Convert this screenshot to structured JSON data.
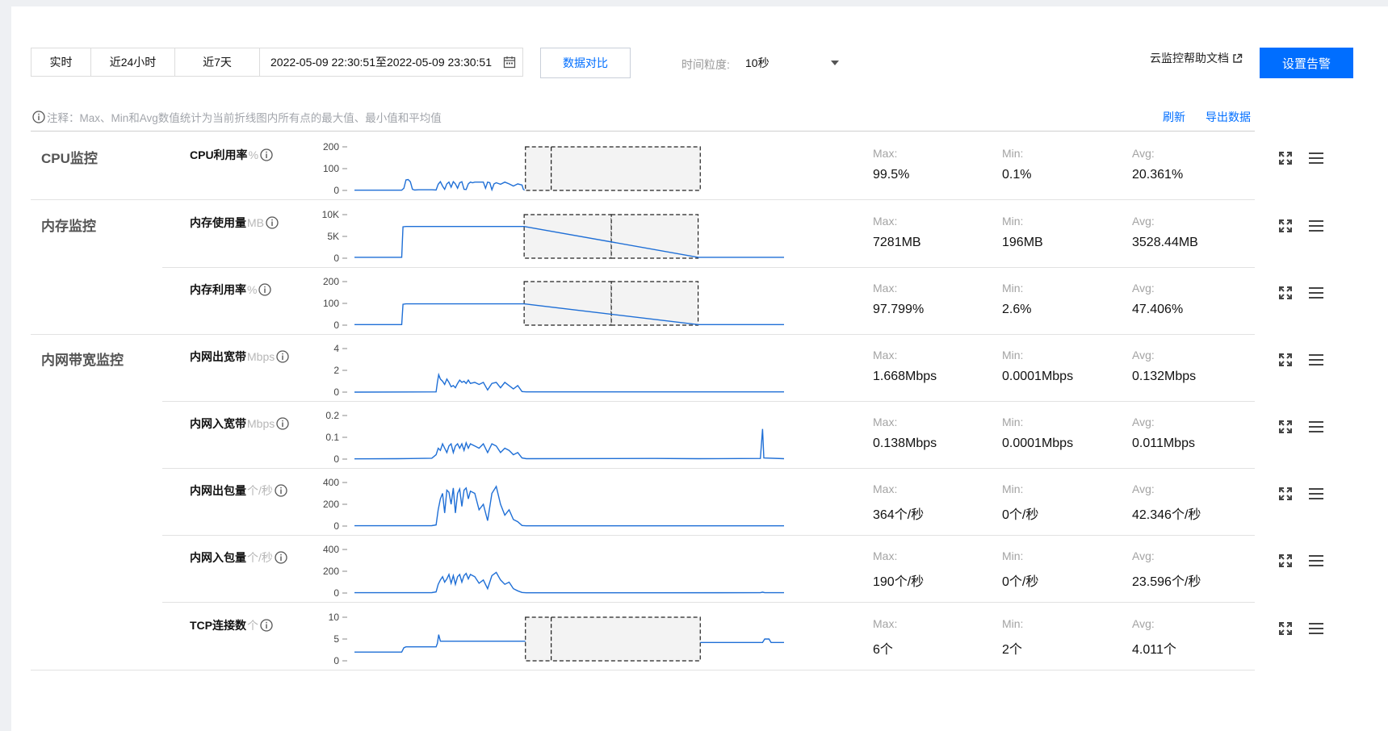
{
  "toolbar": {
    "tabs": [
      "实时",
      "近24小时",
      "近7天"
    ],
    "date_range": "2022-05-09 22:30:51至2022-05-09 23:30:51",
    "compare_label": "数据对比",
    "granularity_label": "时间粒度:",
    "granularity_value": "10秒",
    "help_link": "云监控帮助文档",
    "alarm_button": "设置告警"
  },
  "note": "注释：Max、Min和Avg数值统计为当前折线图内所有点的最大值、最小值和平均值",
  "actions": {
    "refresh": "刷新",
    "export": "导出数据"
  },
  "stat_labels": {
    "max": "Max:",
    "min": "Min:",
    "avg": "Avg:"
  },
  "colors": {
    "accent": "#006eff",
    "line": "#1f6fd6"
  },
  "groups": [
    {
      "title": "CPU监控"
    },
    {
      "title": "内存监控"
    },
    {
      "title": "内网带宽监控"
    }
  ],
  "metrics": [
    {
      "name": "CPU利用率",
      "unit": "%",
      "ticks": [
        "200",
        "100",
        "0"
      ],
      "ymax": 200,
      "max": "99.5%",
      "min": "0.1%",
      "avg": "20.361%",
      "series": [
        [
          0,
          1
        ],
        [
          8,
          1
        ],
        [
          11,
          1
        ],
        [
          11.5,
          10
        ],
        [
          12,
          48
        ],
        [
          12.5,
          50
        ],
        [
          13,
          40
        ],
        [
          13.5,
          5
        ],
        [
          14,
          2
        ],
        [
          15,
          3
        ],
        [
          18,
          3
        ],
        [
          19,
          2
        ],
        [
          19.5,
          28
        ],
        [
          20,
          40
        ],
        [
          20.5,
          20
        ],
        [
          21,
          5
        ],
        [
          21.5,
          30
        ],
        [
          22,
          38
        ],
        [
          22.5,
          15
        ],
        [
          23,
          40
        ],
        [
          23.5,
          30
        ],
        [
          24,
          10
        ],
        [
          24.5,
          35
        ],
        [
          25,
          40
        ],
        [
          25.5,
          5
        ],
        [
          26,
          4
        ],
        [
          26.5,
          30
        ],
        [
          27,
          38
        ],
        [
          27.5,
          35
        ],
        [
          28,
          38
        ],
        [
          29,
          38
        ],
        [
          30,
          38
        ],
        [
          30.5,
          10
        ],
        [
          31,
          38
        ],
        [
          31.5,
          35
        ],
        [
          32,
          3
        ],
        [
          32.5,
          30
        ],
        [
          33,
          35
        ],
        [
          34,
          28
        ],
        [
          35,
          38
        ],
        [
          36,
          30
        ],
        [
          37,
          20
        ],
        [
          38,
          30
        ],
        [
          39,
          25
        ],
        [
          39.3,
          5
        ],
        [
          39.6,
          1
        ],
        [
          50,
          1
        ],
        [
          80,
          1
        ],
        [
          100,
          1
        ]
      ],
      "gaps": [
        [
          39.8,
          45.8
        ],
        [
          45.8,
          80.5
        ]
      ]
    },
    {
      "name": "内存使用量",
      "unit": "MB",
      "ticks": [
        "10K",
        "5K",
        "0"
      ],
      "ymax": 10000,
      "max": "7281MB",
      "min": "196MB",
      "avg": "3528.44MB",
      "series": [
        [
          0,
          196
        ],
        [
          11,
          196
        ],
        [
          11.3,
          7200
        ],
        [
          12,
          7281
        ],
        [
          39.5,
          7281
        ],
        [
          80,
          196
        ],
        [
          100,
          196
        ]
      ],
      "gaps": [
        [
          39.5,
          59.8
        ],
        [
          59.8,
          80
        ]
      ]
    },
    {
      "name": "内存利用率",
      "unit": "%",
      "ticks": [
        "200",
        "100",
        "0"
      ],
      "ymax": 200,
      "max": "97.799%",
      "min": "2.6%",
      "avg": "47.406%",
      "series": [
        [
          0,
          2.6
        ],
        [
          11,
          2.6
        ],
        [
          11.3,
          96
        ],
        [
          12,
          97.8
        ],
        [
          39.5,
          97.8
        ],
        [
          80,
          2.6
        ],
        [
          100,
          2.6
        ]
      ],
      "gaps": [
        [
          39.5,
          59.8
        ],
        [
          59.8,
          80
        ]
      ]
    },
    {
      "name": "内网出宽带",
      "unit": "Mbps",
      "ticks": [
        "4",
        "2",
        "0"
      ],
      "ymax": 4,
      "max": "1.668Mbps",
      "min": "0.0001Mbps",
      "avg": "0.132Mbps",
      "series": [
        [
          0,
          0
        ],
        [
          19,
          0.02
        ],
        [
          19.3,
          0.9
        ],
        [
          19.6,
          1.6
        ],
        [
          20,
          1.2
        ],
        [
          20.5,
          1.0
        ],
        [
          21,
          0.7
        ],
        [
          21.5,
          1.2
        ],
        [
          22,
          0.9
        ],
        [
          22.5,
          0.5
        ],
        [
          23,
          0.6
        ],
        [
          23.5,
          0.4
        ],
        [
          24,
          0.8
        ],
        [
          24.5,
          1.1
        ],
        [
          25,
          0.9
        ],
        [
          25.5,
          1.0
        ],
        [
          26,
          0.8
        ],
        [
          26.5,
          1.1
        ],
        [
          27,
          0.8
        ],
        [
          28,
          0.9
        ],
        [
          29,
          0.7
        ],
        [
          30,
          0.9
        ],
        [
          31,
          0.2
        ],
        [
          32,
          0.8
        ],
        [
          33,
          0.9
        ],
        [
          34,
          0.4
        ],
        [
          35,
          0.9
        ],
        [
          36,
          0.6
        ],
        [
          37,
          0.3
        ],
        [
          38,
          0.6
        ],
        [
          39,
          0.05
        ],
        [
          40,
          0.02
        ],
        [
          100,
          0.02
        ]
      ],
      "gaps": []
    },
    {
      "name": "内网入宽带",
      "unit": "Mbps",
      "ticks": [
        "0.2",
        "0.1",
        "0"
      ],
      "ymax": 0.2,
      "max": "0.138Mbps",
      "min": "0.0001Mbps",
      "avg": "0.011Mbps",
      "series": [
        [
          0,
          0.001
        ],
        [
          10,
          0.002
        ],
        [
          18,
          0.004
        ],
        [
          19,
          0.02
        ],
        [
          19.5,
          0.05
        ],
        [
          20,
          0.04
        ],
        [
          20.5,
          0.07
        ],
        [
          21,
          0.05
        ],
        [
          21.5,
          0.03
        ],
        [
          22,
          0.06
        ],
        [
          22.5,
          0.07
        ],
        [
          23,
          0.03
        ],
        [
          23.5,
          0.06
        ],
        [
          24,
          0.07
        ],
        [
          24.5,
          0.05
        ],
        [
          25,
          0.07
        ],
        [
          25.5,
          0.04
        ],
        [
          26,
          0.075
        ],
        [
          26.5,
          0.05
        ],
        [
          27,
          0.07
        ],
        [
          28,
          0.06
        ],
        [
          29,
          0.05
        ],
        [
          30,
          0.07
        ],
        [
          31,
          0.03
        ],
        [
          32,
          0.07
        ],
        [
          33,
          0.06
        ],
        [
          34,
          0.03
        ],
        [
          35,
          0.05
        ],
        [
          36,
          0.04
        ],
        [
          37,
          0.02
        ],
        [
          38,
          0.03
        ],
        [
          39,
          0.005
        ],
        [
          40,
          0.002
        ],
        [
          70,
          0.003
        ],
        [
          80,
          0.002
        ],
        [
          94.5,
          0.003
        ],
        [
          95,
          0.138
        ],
        [
          95.3,
          0.005
        ],
        [
          100,
          0.002
        ]
      ],
      "gaps": []
    },
    {
      "name": "内网出包量",
      "unit": "个/秒",
      "ticks": [
        "400",
        "200",
        "0"
      ],
      "ymax": 400,
      "max": "364个/秒",
      "min": "0个/秒",
      "avg": "42.346个/秒",
      "series": [
        [
          0,
          3
        ],
        [
          18,
          4
        ],
        [
          19,
          10
        ],
        [
          19.5,
          150
        ],
        [
          20,
          250
        ],
        [
          20.5,
          300
        ],
        [
          21,
          120
        ],
        [
          21.5,
          330
        ],
        [
          22,
          310
        ],
        [
          22.5,
          200
        ],
        [
          23,
          350
        ],
        [
          23.5,
          120
        ],
        [
          24,
          300
        ],
        [
          24.5,
          340
        ],
        [
          25,
          180
        ],
        [
          25.5,
          330
        ],
        [
          26,
          350
        ],
        [
          26.5,
          250
        ],
        [
          27,
          320
        ],
        [
          28,
          300
        ],
        [
          29,
          150
        ],
        [
          30,
          200
        ],
        [
          31,
          50
        ],
        [
          32,
          300
        ],
        [
          33,
          364
        ],
        [
          34,
          200
        ],
        [
          35,
          100
        ],
        [
          36,
          150
        ],
        [
          37,
          60
        ],
        [
          38,
          40
        ],
        [
          39,
          5
        ],
        [
          40,
          2
        ],
        [
          100,
          2
        ]
      ],
      "gaps": []
    },
    {
      "name": "内网入包量",
      "unit": "个/秒",
      "ticks": [
        "400",
        "200",
        "0"
      ],
      "ymax": 400,
      "max": "190个/秒",
      "min": "0个/秒",
      "avg": "23.596个/秒",
      "series": [
        [
          0,
          3
        ],
        [
          18,
          4
        ],
        [
          19,
          10
        ],
        [
          19.5,
          80
        ],
        [
          20,
          120
        ],
        [
          20.5,
          150
        ],
        [
          21,
          100
        ],
        [
          21.5,
          130
        ],
        [
          22,
          170
        ],
        [
          22.5,
          90
        ],
        [
          23,
          160
        ],
        [
          23.5,
          80
        ],
        [
          24,
          150
        ],
        [
          24.5,
          170
        ],
        [
          25,
          100
        ],
        [
          25.5,
          160
        ],
        [
          26,
          180
        ],
        [
          26.5,
          130
        ],
        [
          27,
          170
        ],
        [
          28,
          150
        ],
        [
          29,
          90
        ],
        [
          30,
          120
        ],
        [
          31,
          40
        ],
        [
          32,
          160
        ],
        [
          33,
          190
        ],
        [
          34,
          120
        ],
        [
          35,
          80
        ],
        [
          36,
          100
        ],
        [
          37,
          40
        ],
        [
          38,
          20
        ],
        [
          39,
          5
        ],
        [
          40,
          2
        ],
        [
          94.5,
          3
        ],
        [
          95,
          8
        ],
        [
          95.5,
          3
        ],
        [
          100,
          3
        ]
      ],
      "gaps": []
    },
    {
      "name": "TCP连接数",
      "unit": "个",
      "ticks": [
        "10",
        "5",
        "0"
      ],
      "ymax": 10,
      "max": "6个",
      "min": "2个",
      "avg": "4.011个",
      "series": [
        [
          0,
          2
        ],
        [
          11,
          2
        ],
        [
          11.5,
          3
        ],
        [
          12,
          3.2
        ],
        [
          19,
          3.2
        ],
        [
          19.3,
          4
        ],
        [
          19.6,
          6
        ],
        [
          20,
          4.5
        ],
        [
          21,
          4.5
        ],
        [
          30,
          4.5
        ],
        [
          39.8,
          4.5
        ],
        [
          46,
          2
        ],
        [
          46.5,
          5
        ],
        [
          47,
          2
        ],
        [
          80.5,
          4.2
        ],
        [
          95,
          4.2
        ],
        [
          95.5,
          5
        ],
        [
          96.5,
          5
        ],
        [
          97,
          4.2
        ],
        [
          100,
          4.2
        ]
      ],
      "gaps": [
        [
          39.8,
          45.8
        ],
        [
          45.8,
          80.5
        ]
      ]
    }
  ]
}
